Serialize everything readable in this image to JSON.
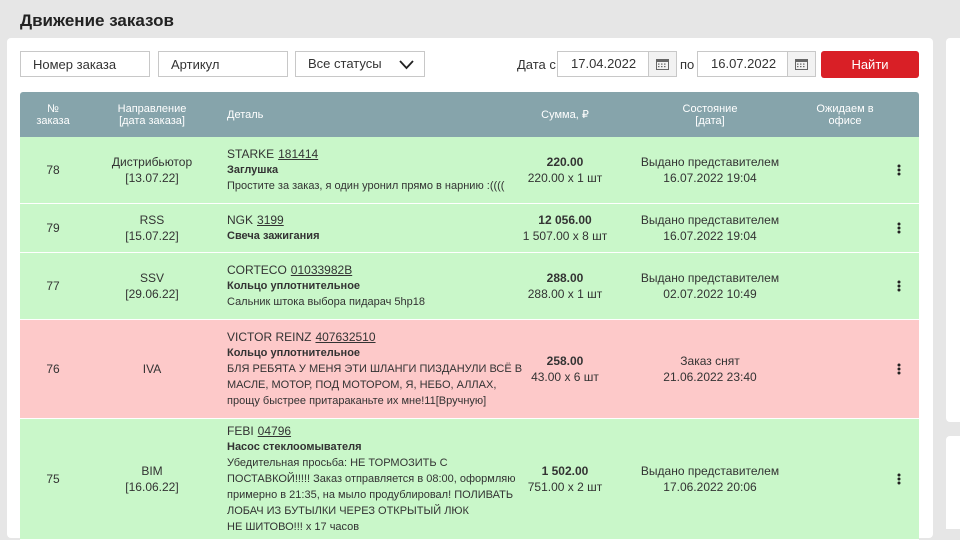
{
  "page_title": "Движение заказов",
  "filters": {
    "order_number_placeholder": "Номер заказа",
    "article_placeholder": "Артикул",
    "status_value": "Все статусы",
    "date_from_label": "Дата с",
    "date_from": "17.04.2022",
    "date_to_label": "по",
    "date_to": "16.07.2022",
    "find_label": "Найти"
  },
  "table": {
    "headers": {
      "number": [
        "№",
        "заказа"
      ],
      "direction": [
        "Направление",
        "[дата заказа]"
      ],
      "detail": "Деталь",
      "sum": "Сумма, ₽",
      "state": [
        "Состояние",
        "[дата]"
      ],
      "expected": [
        "Ожидаем в",
        "офисе"
      ]
    },
    "rows": [
      {
        "number": "78",
        "direction": "Дистрибьютор",
        "order_date": "[13.07.22]",
        "brand": "STARKE",
        "article": "181414",
        "name": "Заглушка",
        "note": [
          "Простите за заказ, я один уронил прямо в нарнию :(((("
        ],
        "sum_total": "220.00",
        "sum_detail": "220.00 x 1 шт",
        "state": "Выдано представителем",
        "state_date": "16.07.2022 19:04",
        "status": "green"
      },
      {
        "number": "79",
        "direction": "RSS",
        "order_date": "[15.07.22]",
        "brand": "NGK",
        "article": "3199",
        "name": "Свеча зажигания",
        "note": [],
        "sum_total": "12 056.00",
        "sum_detail": "1 507.00 x 8 шт",
        "state": "Выдано представителем",
        "state_date": "16.07.2022 19:04",
        "status": "green"
      },
      {
        "number": "77",
        "direction": "SSV",
        "order_date": "[29.06.22]",
        "brand": "CORTECO",
        "article": "01033982B",
        "name": "Кольцо уплотнительное",
        "note": [
          "Сальник штока выбора пидарач 5hp18"
        ],
        "sum_total": "288.00",
        "sum_detail": "288.00 x 1 шт",
        "state": "Выдано представителем",
        "state_date": "02.07.2022 10:49",
        "status": "green"
      },
      {
        "number": "76",
        "direction": "IVA",
        "order_date": "",
        "brand": "VICTOR REINZ",
        "article": "407632510",
        "name": "Кольцо уплотнительное",
        "note": [
          "БЛЯ РЕБЯТА У МЕНЯ ЭТИ ШЛАНГИ ПИЗДАНУЛИ ВСЁ В",
          "МАСЛЕ, МОТОР, ПОД МОТОРОМ, Я, НЕБО, АЛЛАХ,",
          "прощу быстрее притараканьте их мне!11[Вручную]"
        ],
        "sum_total": "258.00",
        "sum_detail": "43.00 x 6 шт",
        "state": "Заказ снят",
        "state_date": "21.06.2022 23:40",
        "status": "red"
      },
      {
        "number": "75",
        "direction": "BIM",
        "order_date": "[16.06.22]",
        "brand": "FEBI",
        "article": "04796",
        "name": "Насос стеклоомывателя",
        "note": [
          "Убедительная просьба: НЕ ТОРМОЗИТЬ С",
          "ПОСТАВКОЙ!!!!! Заказ отправляется в 08:00, оформляю",
          "примерно в 21:35, на мыло продублировал! ПОЛИВАТЬ",
          "ЛОБАЧ ИЗ БУТЫЛКИ ЧЕРЕЗ ОТКРЫТЫЙ ЛЮК",
          "НЕ ШИТОВО!!! x 17 часов"
        ],
        "sum_total": "1 502.00",
        "sum_detail": "751.00 x 2 шт",
        "state": "Выдано представителем",
        "state_date": "17.06.2022 20:06",
        "status": "green"
      }
    ]
  },
  "colors": {
    "accent_red": "#d91f26",
    "header_bg": "#86a4ab",
    "row_green": "#c9f7c9",
    "row_red": "#fdc9c9"
  },
  "icons": {
    "status_select": "chevron-down-icon",
    "date_picker": "calendar-icon",
    "row_menu": "kebab-menu-icon"
  }
}
